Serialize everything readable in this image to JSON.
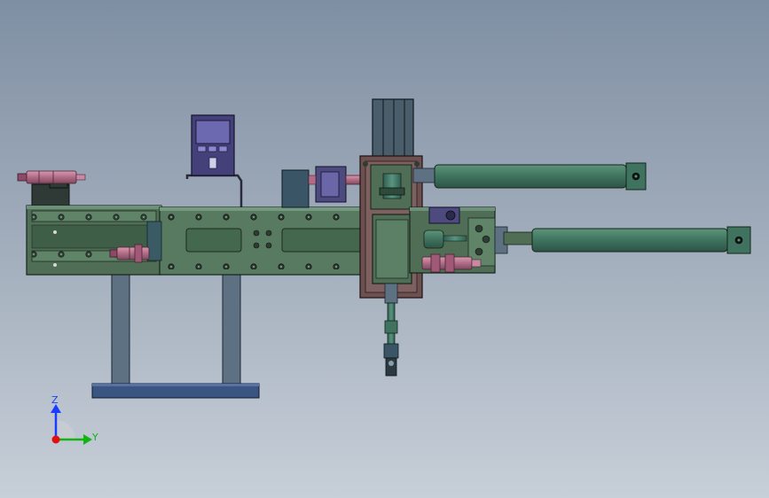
{
  "viewport": {
    "background_top": "#7f8fa3",
    "background_bottom": "#c7cfd8"
  },
  "triad": {
    "z_label": "Z",
    "y_label": "Y",
    "z_color": "#1a3cff",
    "y_color": "#13b313",
    "origin_color": "#e01010"
  },
  "colors": {
    "frame_green": "#4f6e55",
    "frame_green_light": "#5f8468",
    "cylinder_green": "#3f735f",
    "stand_steel": "#5e7182",
    "base_blue": "#3b5582",
    "sensor_pink": "#b06c86",
    "block_purple": "#4d4a7e",
    "screen_purple": "#43407a",
    "slot_green": "#43684e",
    "plate_maroon": "#6d5150"
  },
  "icons": {
    "triad": "view-orientation-triad-icon"
  }
}
